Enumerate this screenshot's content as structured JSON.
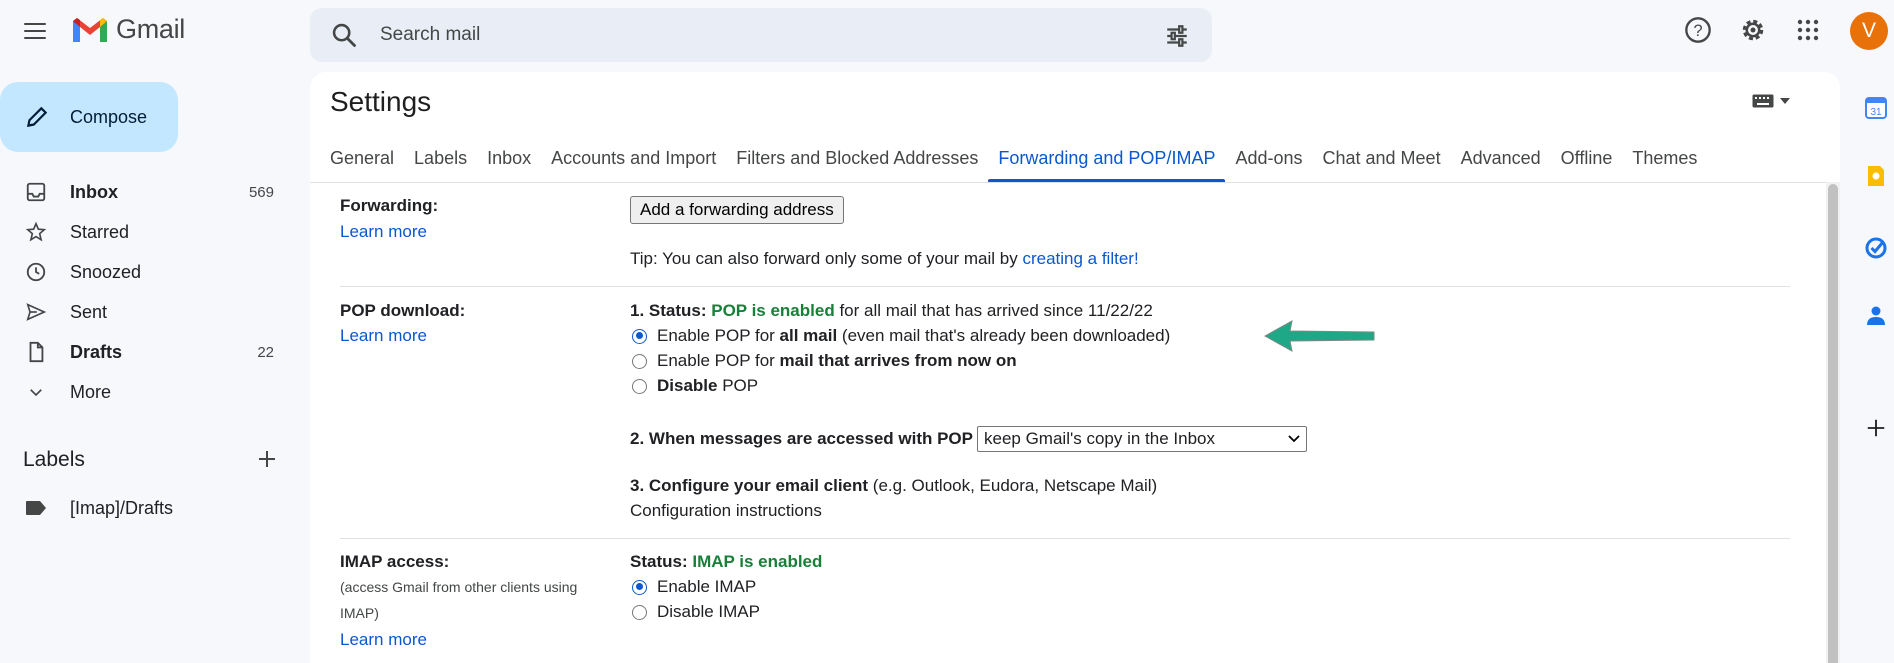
{
  "app": {
    "name": "Gmail"
  },
  "search": {
    "placeholder": "Search mail"
  },
  "user": {
    "avatar_letter": "V",
    "avatar_color": "#e8710a"
  },
  "compose": {
    "label": "Compose"
  },
  "sidebar": {
    "items": [
      {
        "label": "Inbox",
        "count": "569",
        "icon": "inbox-icon",
        "bold": true
      },
      {
        "label": "Starred",
        "count": "",
        "icon": "star-icon",
        "bold": false
      },
      {
        "label": "Snoozed",
        "count": "",
        "icon": "clock-icon",
        "bold": false
      },
      {
        "label": "Sent",
        "count": "",
        "icon": "send-icon",
        "bold": false
      },
      {
        "label": "Drafts",
        "count": "22",
        "icon": "draft-icon",
        "bold": true
      },
      {
        "label": "More",
        "count": "",
        "icon": "chevron-down-icon",
        "bold": false
      }
    ],
    "labels_heading": "Labels",
    "labels": [
      {
        "label": "[Imap]/Drafts"
      }
    ]
  },
  "settings": {
    "title": "Settings",
    "tabs": [
      "General",
      "Labels",
      "Inbox",
      "Accounts and Import",
      "Filters and Blocked Addresses",
      "Forwarding and POP/IMAP",
      "Add-ons",
      "Chat and Meet",
      "Advanced",
      "Offline",
      "Themes"
    ],
    "active_tab": "Forwarding and POP/IMAP",
    "forwarding": {
      "label": "Forwarding:",
      "learn_more": "Learn more",
      "button": "Add a forwarding address",
      "tip_prefix": "Tip: You can also forward only some of your mail by ",
      "tip_link": "creating a filter!"
    },
    "pop": {
      "label": "POP download:",
      "learn_more": "Learn more",
      "status_prefix": "1. Status: ",
      "status_value": "POP is enabled",
      "status_suffix": " for all mail that has arrived since 11/22/22",
      "opt1_pre": "Enable POP for ",
      "opt1_bold": "all mail",
      "opt1_post": " (even mail that's already been downloaded)",
      "opt2_pre": "Enable POP for ",
      "opt2_bold": "mail that arrives from now on",
      "opt3_bold": "Disable",
      "opt3_post": " POP",
      "when_accessed": "2. When messages are accessed with POP",
      "select_value": "keep Gmail's copy in the Inbox",
      "configure_bold": "3. Configure your email client",
      "configure_rest": " (e.g. Outlook, Eudora, Netscape Mail)",
      "config_link": "Configuration instructions"
    },
    "imap": {
      "label": "IMAP access:",
      "sub": "(access Gmail from other clients using IMAP)",
      "learn_more": "Learn more",
      "status_prefix": "Status: ",
      "status_value": "IMAP is enabled",
      "opt1": "Enable IMAP",
      "opt2": "Disable IMAP"
    }
  },
  "colors": {
    "accent": "#0b57d0",
    "status_green": "#188038",
    "arrow": "#1fa888"
  }
}
